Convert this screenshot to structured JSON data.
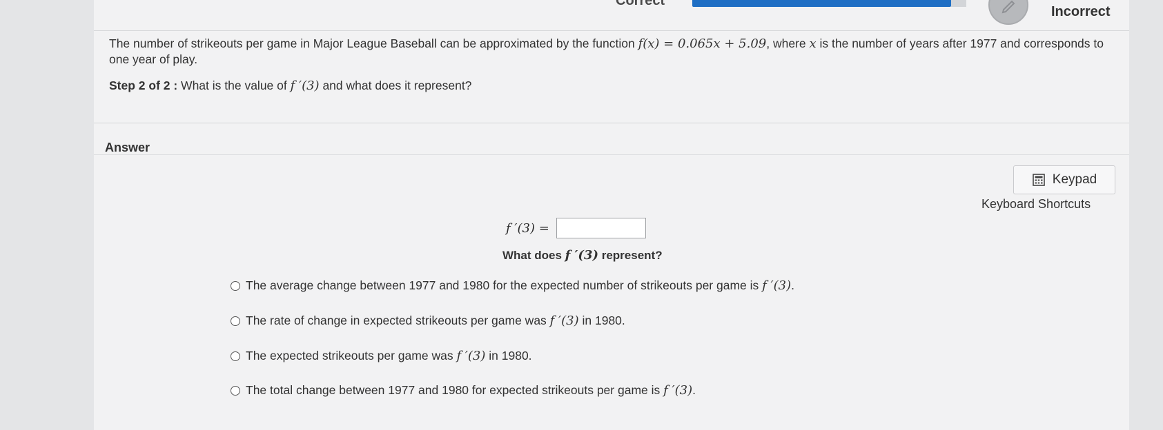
{
  "status": {
    "correct_label": "Correct",
    "incorrect_label": "Incorrect",
    "progress_percent": 94
  },
  "question": {
    "text_before": "The number of strikeouts per game in Major League Baseball can be approximated by the function ",
    "function_math": "f(x) = 0.065x + 5.09",
    "text_after_1": ", where ",
    "variable": "x",
    "text_after_2": " is the number of years after 1977 and corresponds to one year of play."
  },
  "step": {
    "label": "Step 2 of 2 :",
    "text_before": " What is the value of ",
    "math": "f ′(3)",
    "text_after": " and what does it represent?"
  },
  "answer": {
    "label": "Answer",
    "keypad_label": "Keypad",
    "shortcuts_label": "Keyboard Shortcuts",
    "fprime_lhs": "f ′(3) =",
    "input_value": "",
    "represent_before": "What does ",
    "represent_math": "f ′(3)",
    "represent_after": " represent?"
  },
  "options": [
    {
      "before": "The average change between 1977 and 1980 for the expected number of strikeouts per game is ",
      "math": "f ′(3)",
      "after": "."
    },
    {
      "before": "The rate of change in expected strikeouts per game was ",
      "math": "f ′(3)",
      "after": " in 1980."
    },
    {
      "before": "The expected strikeouts per game was ",
      "math": "f ′(3)",
      "after": " in 1980."
    },
    {
      "before": "The total change between 1977 and 1980 for expected strikeouts per game is ",
      "math": "f ′(3)",
      "after": "."
    }
  ]
}
